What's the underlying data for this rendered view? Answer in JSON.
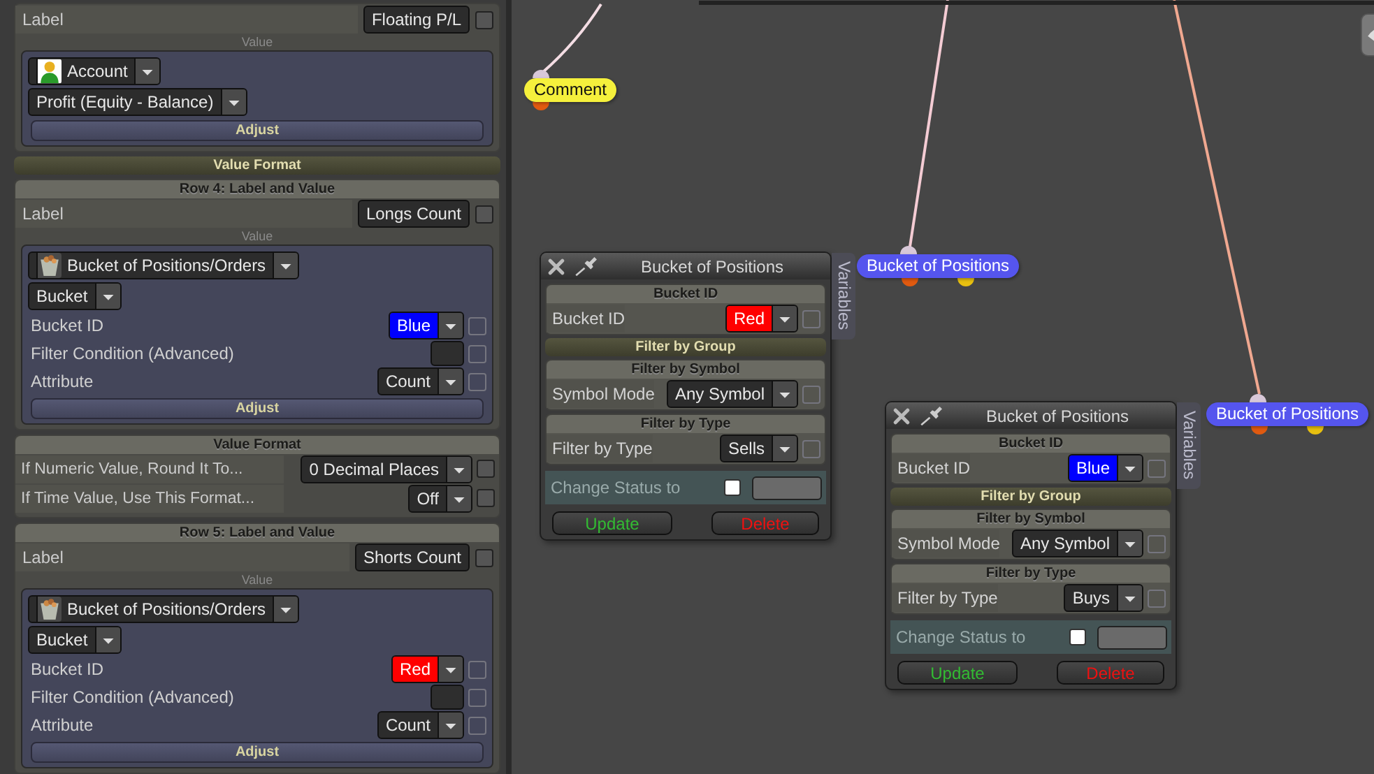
{
  "left_panel": {
    "rows": [
      {
        "label": "Label",
        "value": "Floating P/L",
        "checked": false,
        "value_caption": "Value",
        "source": {
          "kind": "account",
          "name": "Account"
        },
        "mode_text": "Profit (Equity - Balance)",
        "params": [],
        "adjust": "Adjust",
        "format": {
          "title": "Value Format",
          "expanded": false
        }
      },
      {
        "title": "Row 4: Label and Value",
        "label": "Label",
        "value": "Longs Count",
        "checked": false,
        "value_caption": "Value",
        "source": {
          "kind": "bucket",
          "name": "Bucket of Positions/Orders"
        },
        "mode_text": "Bucket",
        "params": [
          {
            "label": "Bucket ID",
            "kind": "color",
            "value": "Blue",
            "color": "#0000ff",
            "checked": false
          },
          {
            "label": "Filter Condition (Advanced)",
            "kind": "field",
            "checked": false
          },
          {
            "label": "Attribute",
            "kind": "select",
            "value": "Count",
            "checked": false
          }
        ],
        "adjust": "Adjust",
        "format": {
          "title": "Value Format",
          "expanded": true,
          "options": [
            {
              "label": "If Numeric Value, Round It To...",
              "value": "0 Decimal Places",
              "checked": false
            },
            {
              "label": "If Time Value, Use This Format...",
              "value": "Off",
              "checked": false
            }
          ]
        }
      },
      {
        "title": "Row 5: Label and Value",
        "label": "Label",
        "value": "Shorts Count",
        "checked": false,
        "value_caption": "Value",
        "source": {
          "kind": "bucket",
          "name": "Bucket of Positions/Orders"
        },
        "mode_text": "Bucket",
        "params": [
          {
            "label": "Bucket ID",
            "kind": "color",
            "value": "Red",
            "color": "#ff0000",
            "checked": false
          },
          {
            "label": "Filter Condition (Advanced)",
            "kind": "field",
            "checked": false
          },
          {
            "label": "Attribute",
            "kind": "select",
            "value": "Count",
            "checked": false
          }
        ],
        "adjust": "Adjust"
      }
    ]
  },
  "canvas": {
    "nodes": [
      {
        "label": "Comment",
        "color": "#f5f03c"
      },
      {
        "label": "Bucket of Positions",
        "color": "#5555ee"
      },
      {
        "label": "Bucket of Positions",
        "color": "#5555ee"
      }
    ],
    "panels": [
      {
        "title": "Bucket of Positions",
        "side_tab": "Variables",
        "sections": [
          {
            "title": "Bucket ID",
            "expanded": true,
            "rows": [
              {
                "label": "Bucket ID",
                "kind": "color",
                "value": "Red",
                "color": "#ff0000",
                "checked": false
              }
            ]
          },
          {
            "title": "Filter by Group",
            "expanded": false
          },
          {
            "title": "Filter by Symbol",
            "expanded": true,
            "rows": [
              {
                "label": "Symbol Mode",
                "kind": "select",
                "value": "Any Symbol",
                "checked": false
              }
            ]
          },
          {
            "title": "Filter by Type",
            "expanded": true,
            "rows": [
              {
                "label": "Filter by Type",
                "kind": "select",
                "value": "Sells",
                "checked": false
              }
            ]
          }
        ],
        "status": {
          "label": "Change Status to",
          "checked": false
        },
        "buttons": [
          {
            "label": "Update",
            "kind": "update"
          },
          {
            "label": "Delete",
            "kind": "delete"
          }
        ]
      },
      {
        "title": "Bucket of Positions",
        "side_tab": "Variables",
        "sections": [
          {
            "title": "Bucket ID",
            "expanded": true,
            "rows": [
              {
                "label": "Bucket ID",
                "kind": "color",
                "value": "Blue",
                "color": "#0000ff",
                "checked": false
              }
            ]
          },
          {
            "title": "Filter by Group",
            "expanded": false
          },
          {
            "title": "Filter by Symbol",
            "expanded": true,
            "rows": [
              {
                "label": "Symbol Mode",
                "kind": "select",
                "value": "Any Symbol",
                "checked": false
              }
            ]
          },
          {
            "title": "Filter by Type",
            "expanded": true,
            "rows": [
              {
                "label": "Filter by Type",
                "kind": "select",
                "value": "Buys",
                "checked": false
              }
            ]
          }
        ],
        "status": {
          "label": "Change Status to",
          "checked": false
        },
        "buttons": [
          {
            "label": "Update",
            "kind": "update"
          },
          {
            "label": "Delete",
            "kind": "delete"
          }
        ]
      }
    ]
  }
}
